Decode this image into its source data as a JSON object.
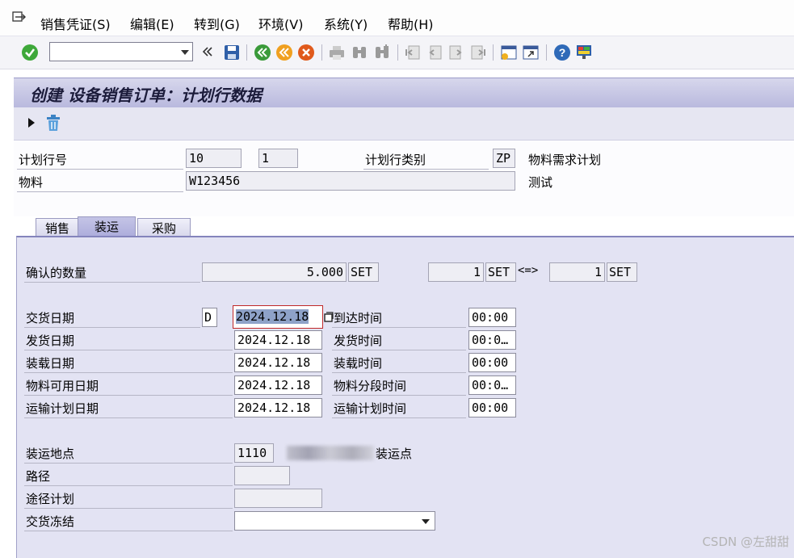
{
  "menu": {
    "items": [
      {
        "label": "销售凭证(S)"
      },
      {
        "label": "编辑(E)"
      },
      {
        "label": "转到(G)"
      },
      {
        "label": "环境(V)"
      },
      {
        "label": "系统(Y)"
      },
      {
        "label": "帮助(H)"
      }
    ]
  },
  "toolbar": {
    "command_value": "",
    "icons": [
      "enter-icon",
      "back-nav-icon",
      "save-icon",
      "back-icon",
      "exit-icon",
      "cancel-icon",
      "print-icon",
      "find-icon",
      "find-next-icon",
      "first-page-icon",
      "prev-page-icon",
      "next-page-icon",
      "last-page-icon",
      "new-session-icon",
      "shortcut-icon",
      "help-icon",
      "customize-layout-icon"
    ]
  },
  "title": "创建 设备销售订单：计划行数据",
  "header": {
    "schedule_line_label": "计划行号",
    "schedule_line_item": "10",
    "schedule_line_no": "1",
    "schedule_line_category_label": "计划行类别",
    "schedule_line_category": "ZP",
    "schedule_line_category_text": "物料需求计划",
    "material_label": "物料",
    "material_value": "W123456",
    "material_text": "测试"
  },
  "tabs": [
    {
      "label": "销售",
      "active": false
    },
    {
      "label": "装运",
      "active": true
    },
    {
      "label": "采购",
      "active": false
    }
  ],
  "shipping": {
    "confirmed_qty_label": "确认的数量",
    "confirmed_qty": "5.000",
    "confirmed_unit": "SET",
    "conv_left": "1",
    "conv_left_unit": "SET",
    "conv_symbol": "<=>",
    "conv_right": "1",
    "conv_right_unit": "SET",
    "delivery_date_label": "交货日期",
    "delivery_date_format": "D",
    "delivery_date": "2024.12.18",
    "arrival_time_label": "到达时间",
    "arrival_time": "00:00",
    "goods_issue_date_label": "发货日期",
    "goods_issue_date": "2024.12.18",
    "goods_issue_time_label": "发货时间",
    "goods_issue_time": "00:0…",
    "loading_date_label": "装载日期",
    "loading_date": "2024.12.18",
    "loading_time_label": "装载时间",
    "loading_time": "00:00",
    "mat_avail_date_label": "物料可用日期",
    "mat_avail_date": "2024.12.18",
    "mat_staging_time_label": "物料分段时间",
    "mat_staging_time": "00:0…",
    "transp_plan_date_label": "运输计划日期",
    "transp_plan_date": "2024.12.18",
    "transp_plan_time_label": "运输计划时间",
    "transp_plan_time": "00:00",
    "shipping_point_label": "装运地点",
    "shipping_point": "1110",
    "shipping_point_desc": "装运点",
    "route_label": "路径",
    "route_value": "",
    "route_schedule_label": "途径计划",
    "route_schedule_value": "",
    "delivery_block_label": "交货冻结",
    "delivery_block_value": ""
  },
  "watermark": "CSDN @左甜甜",
  "colors": {
    "title_bg": "#c4c4e6",
    "panel_bg": "#e3e3f3",
    "focus_border": "#c02828",
    "selected_text_bg": "#8ea2c8"
  }
}
